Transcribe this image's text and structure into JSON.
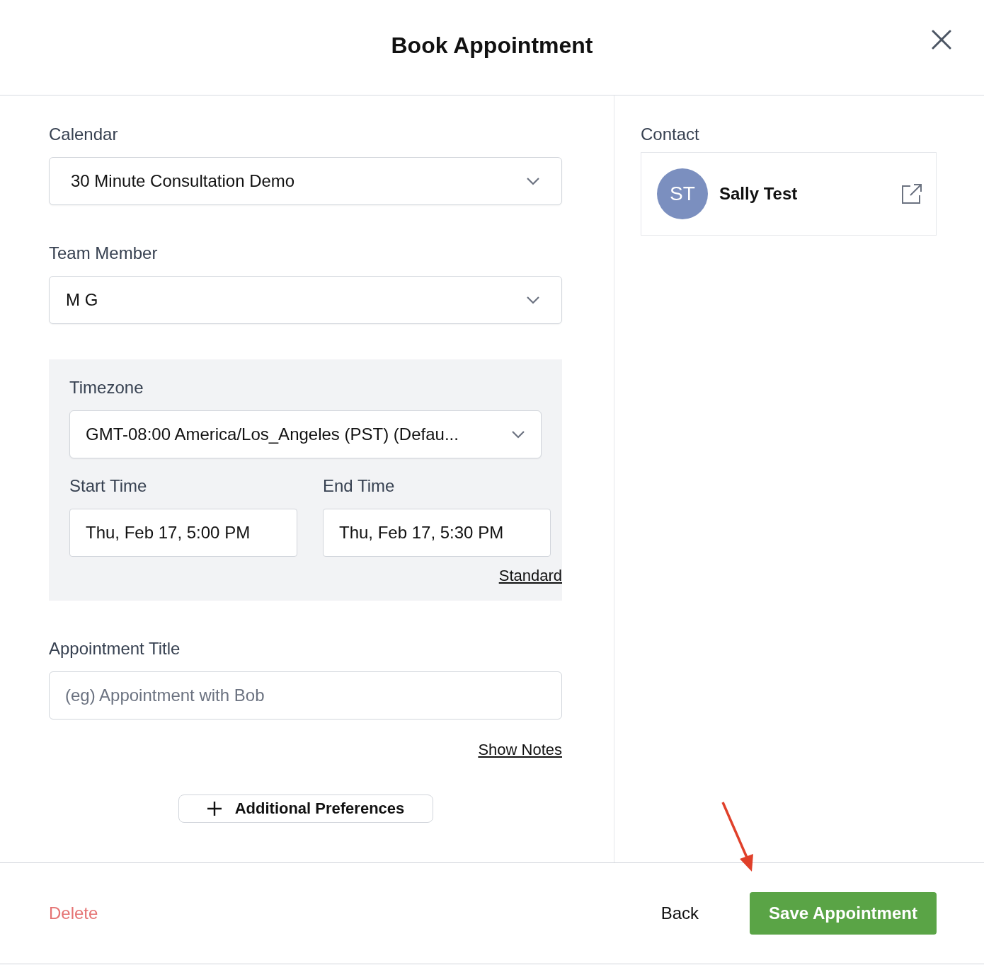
{
  "title": "Book Appointment",
  "calendar": {
    "label": "Calendar",
    "value": "30 Minute Consultation Demo"
  },
  "team_member": {
    "label": "Team Member",
    "value": "M G"
  },
  "timezone": {
    "label": "Timezone",
    "value": "GMT-08:00 America/Los_Angeles (PST) (Defau..."
  },
  "start_time": {
    "label": "Start Time",
    "value": "Thu, Feb 17, 5:00 PM"
  },
  "end_time": {
    "label": "End Time",
    "value": "Thu, Feb 17, 5:30 PM"
  },
  "standard_link": "Standard",
  "appointment_title": {
    "label": "Appointment Title",
    "placeholder": "(eg) Appointment with Bob"
  },
  "show_notes": "Show Notes",
  "additional_preferences": "Additional Preferences",
  "contact": {
    "label": "Contact",
    "initials": "ST",
    "name": "Sally Test"
  },
  "footer": {
    "delete": "Delete",
    "back": "Back",
    "save": "Save Appointment"
  }
}
